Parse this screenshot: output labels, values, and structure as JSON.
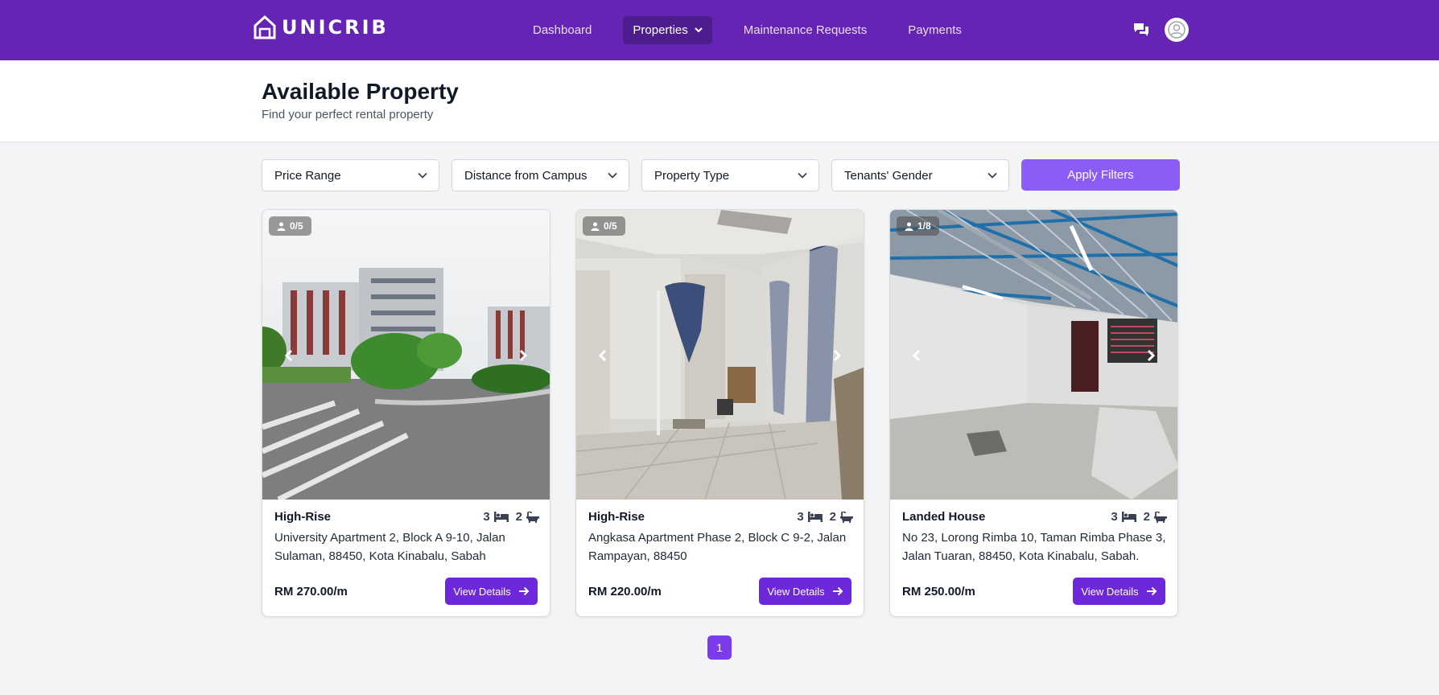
{
  "nav": {
    "logo_text": "UNICRIB",
    "links": [
      {
        "label": "Dashboard"
      },
      {
        "label": "Properties"
      },
      {
        "label": "Maintenance Requests"
      },
      {
        "label": "Payments"
      }
    ],
    "icons": {
      "chat": "chat-bubbles-icon",
      "avatar": "user-avatar-icon"
    }
  },
  "header": {
    "title": "Available Property",
    "subtitle": "Find your perfect rental property"
  },
  "filters": {
    "price_range": "Price Range",
    "distance": "Distance from Campus",
    "property_type": "Property Type",
    "gender": "Tenants' Gender",
    "apply": "Apply Filters"
  },
  "cards": [
    {
      "occupancy": "0/5",
      "type": "High-Rise",
      "beds": "3",
      "baths": "2",
      "address": "University Apartment 2, Block A 9-10, Jalan Sulaman, 88450, Kota Kinabalu, Sabah",
      "price": "RM 270.00/m",
      "button": "View Details"
    },
    {
      "occupancy": "0/5",
      "type": "High-Rise",
      "beds": "3",
      "baths": "2",
      "address": "Angkasa Apartment Phase 2, Block C 9-2, Jalan Rampayan, 88450",
      "price": "RM 220.00/m",
      "button": "View Details"
    },
    {
      "occupancy": "1/8",
      "type": "Landed House",
      "beds": "3",
      "baths": "2",
      "address": "No 23, Lorong Rimba 10, Taman Rimba Phase 3, Jalan Tuaran, 88450, Kota Kinabalu, Sabah.",
      "price": "RM 250.00/m",
      "button": "View Details"
    }
  ],
  "pagination": {
    "current": "1"
  },
  "colors": {
    "navbar": "#6524b4",
    "accent": "#6d28d9",
    "apply_button": "#8b5cf6"
  }
}
